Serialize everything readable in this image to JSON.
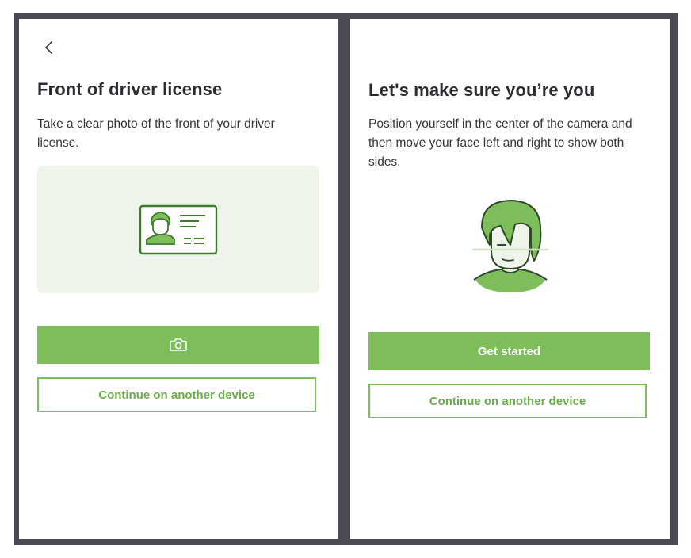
{
  "colors": {
    "accent": "#7dbe5b",
    "accent_text": "#6aae48",
    "illustration_bg": "#eef4ea",
    "icon_dark_green": "#3f7a2d",
    "frame_bg": "#4a4b55",
    "title_text": "#2b2d33"
  },
  "license_screen": {
    "back_icon": "chevron-left-icon",
    "title": "Front of driver license",
    "description": "Take a clear photo of the front of your driver license.",
    "illustration_icon": "driver-license-icon",
    "capture_button_icon": "camera-icon",
    "continue_button_label": "Continue on another device"
  },
  "selfie_screen": {
    "title": "Let's make sure you’re you",
    "description": "Position yourself in the center of the camera and then move your face left and right to show both sides.",
    "illustration_icon": "face-scan-icon",
    "get_started_label": "Get started",
    "continue_button_label": "Continue on another device"
  }
}
